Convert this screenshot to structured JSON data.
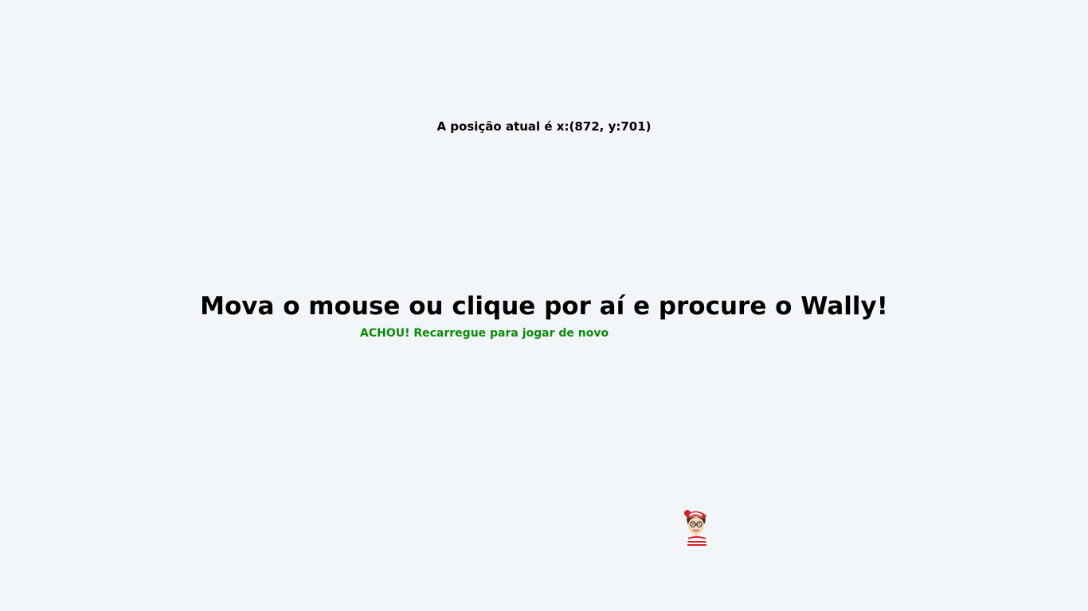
{
  "position_readout": {
    "text": "A posição atual é x:(872, y:701)"
  },
  "headline": {
    "text": "Mova o mouse ou clique por aí e procure o Wally!"
  },
  "status": {
    "found_message": "ACHOU! Recarregue para jogar de novo",
    "color": "#0a8a0a"
  },
  "wally": {
    "icon": "wally-icon"
  },
  "colors": {
    "background": "#f3f6f9",
    "text": "#000000",
    "success": "#0a8a0a",
    "wally_red": "#d4202a"
  }
}
